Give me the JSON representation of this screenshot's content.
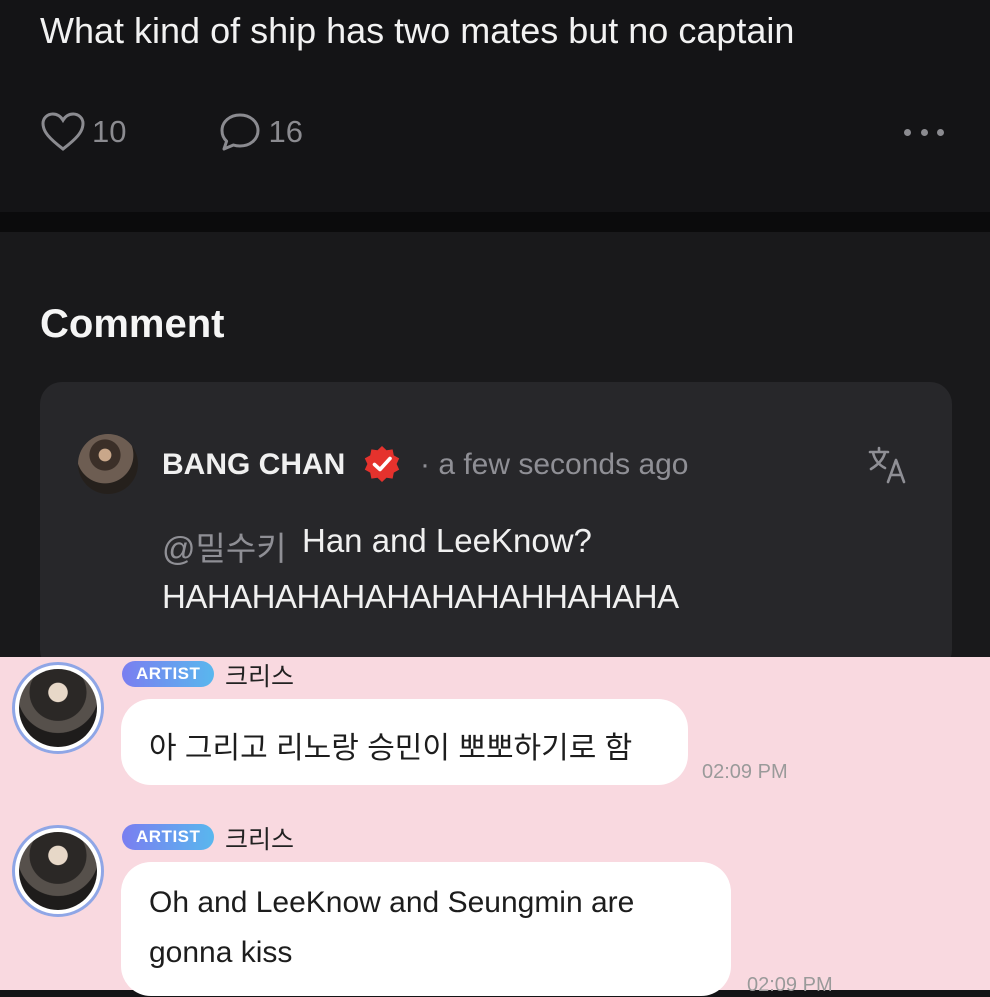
{
  "post": {
    "text": "What kind of ship has two mates but no captain",
    "like_count": "10",
    "comment_count": "16",
    "icons": [
      "heart-icon",
      "comment-bubble-icon",
      "more-options-icon"
    ]
  },
  "comments": {
    "section_title": "Comment",
    "items": [
      {
        "author": "BANG CHAN",
        "timestamp": "· a few seconds ago",
        "mention": "@밀수키",
        "text_line1": "Han and LeeKnow?",
        "text_line2": "HAHAHAHAHAHAHAHAHHAHAHA",
        "verified_color": "#e5322d"
      }
    ]
  },
  "chat": {
    "badge_color_start": "#7a7ef0",
    "badge_color_end": "#59b7ee",
    "messages": [
      {
        "badge": "ARTIST",
        "sender": "크리스",
        "text": "아 그리고 리노랑 승민이 뽀뽀하기로 함",
        "time": "02:09 PM"
      },
      {
        "badge": "ARTIST",
        "sender": "크리스",
        "text_line1": "Oh and LeeKnow and Seungmin are",
        "text_line2": "gonna kiss",
        "time": "02:09 PM"
      }
    ]
  }
}
